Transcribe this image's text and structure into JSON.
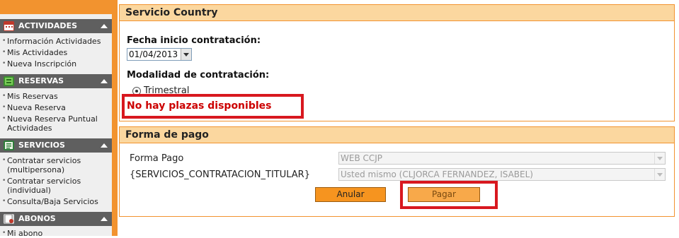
{
  "sidebar": {
    "sections": [
      {
        "title": "ACTIVIDADES",
        "icon": "calendar-icon",
        "items": [
          "Información Actividades",
          "Mis Actividades",
          "Nueva Inscripción"
        ]
      },
      {
        "title": "RESERVAS",
        "icon": "reservation-icon",
        "items": [
          "Mis Reservas",
          "Nueva Reserva",
          "Nueva Reserva Puntual Actividades"
        ]
      },
      {
        "title": "SERVICIOS",
        "icon": "services-icon",
        "items": [
          "Contratar servicios (multipersona)",
          "Contratar servicios (individual)",
          "Consulta/Baja Servicios"
        ]
      },
      {
        "title": "ABONOS",
        "icon": "card-icon",
        "items": [
          "Mi abono"
        ]
      }
    ]
  },
  "servicio": {
    "title": "Servicio Country",
    "fecha_label": "Fecha inicio contratación:",
    "fecha_value": "01/04/2013",
    "modalidad_label": "Modalidad de contratación:",
    "modalidad_option": "Trimestral",
    "error_message": "No hay plazas disponibles"
  },
  "pago": {
    "title": "Forma de pago",
    "forma_label": "Forma Pago",
    "forma_value": "WEB CCJP",
    "titular_label": "{SERVICIOS_CONTRATACION_TITULAR}",
    "titular_value": "Usted mismo (CLJORCA FERNANDEZ, ISABEL)",
    "anular_label": "Anular",
    "pagar_label": "Pagar"
  },
  "colors": {
    "accent": "#f2932f",
    "header_bg": "#fbd79f",
    "highlight": "#d8181f",
    "error_text": "#cc0000"
  }
}
